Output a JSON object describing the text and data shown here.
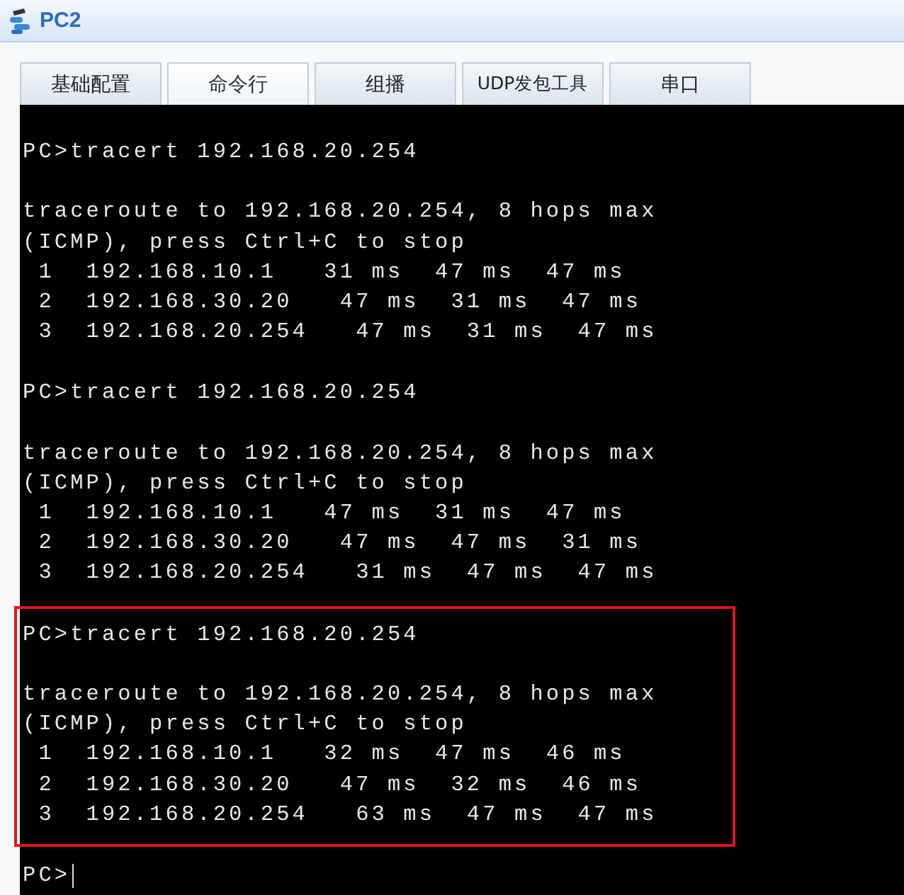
{
  "window": {
    "title": "PC2"
  },
  "tabs": [
    {
      "label": "基础配置",
      "selected": false
    },
    {
      "label": "命令行",
      "selected": true
    },
    {
      "label": "组播",
      "selected": false
    },
    {
      "label": "UDP发包工具",
      "selected": false
    },
    {
      "label": "串口",
      "selected": false
    }
  ],
  "terminal": {
    "sessions": [
      {
        "command": "PC>tracert 192.168.20.254",
        "highlighted": false,
        "output": [
          "traceroute to 192.168.20.254, 8 hops max",
          "(ICMP), press Ctrl+C to stop",
          " 1  192.168.10.1   31 ms  47 ms  47 ms",
          " 2  192.168.30.20   47 ms  31 ms  47 ms",
          " 3  192.168.20.254   47 ms  31 ms  47 ms"
        ]
      },
      {
        "command": "PC>tracert 192.168.20.254",
        "highlighted": false,
        "output": [
          "traceroute to 192.168.20.254, 8 hops max",
          "(ICMP), press Ctrl+C to stop",
          " 1  192.168.10.1   47 ms  31 ms  47 ms",
          " 2  192.168.30.20   47 ms  47 ms  31 ms",
          " 3  192.168.20.254   31 ms  47 ms  47 ms"
        ]
      },
      {
        "command": "PC>tracert 192.168.20.254",
        "highlighted": true,
        "output": [
          "traceroute to 192.168.20.254, 8 hops max",
          "(ICMP), press Ctrl+C to stop",
          " 1  192.168.10.1   32 ms  47 ms  46 ms",
          " 2  192.168.30.20   47 ms  32 ms  46 ms",
          " 3  192.168.20.254   63 ms  47 ms  47 ms"
        ]
      }
    ],
    "prompt": "PC>"
  }
}
